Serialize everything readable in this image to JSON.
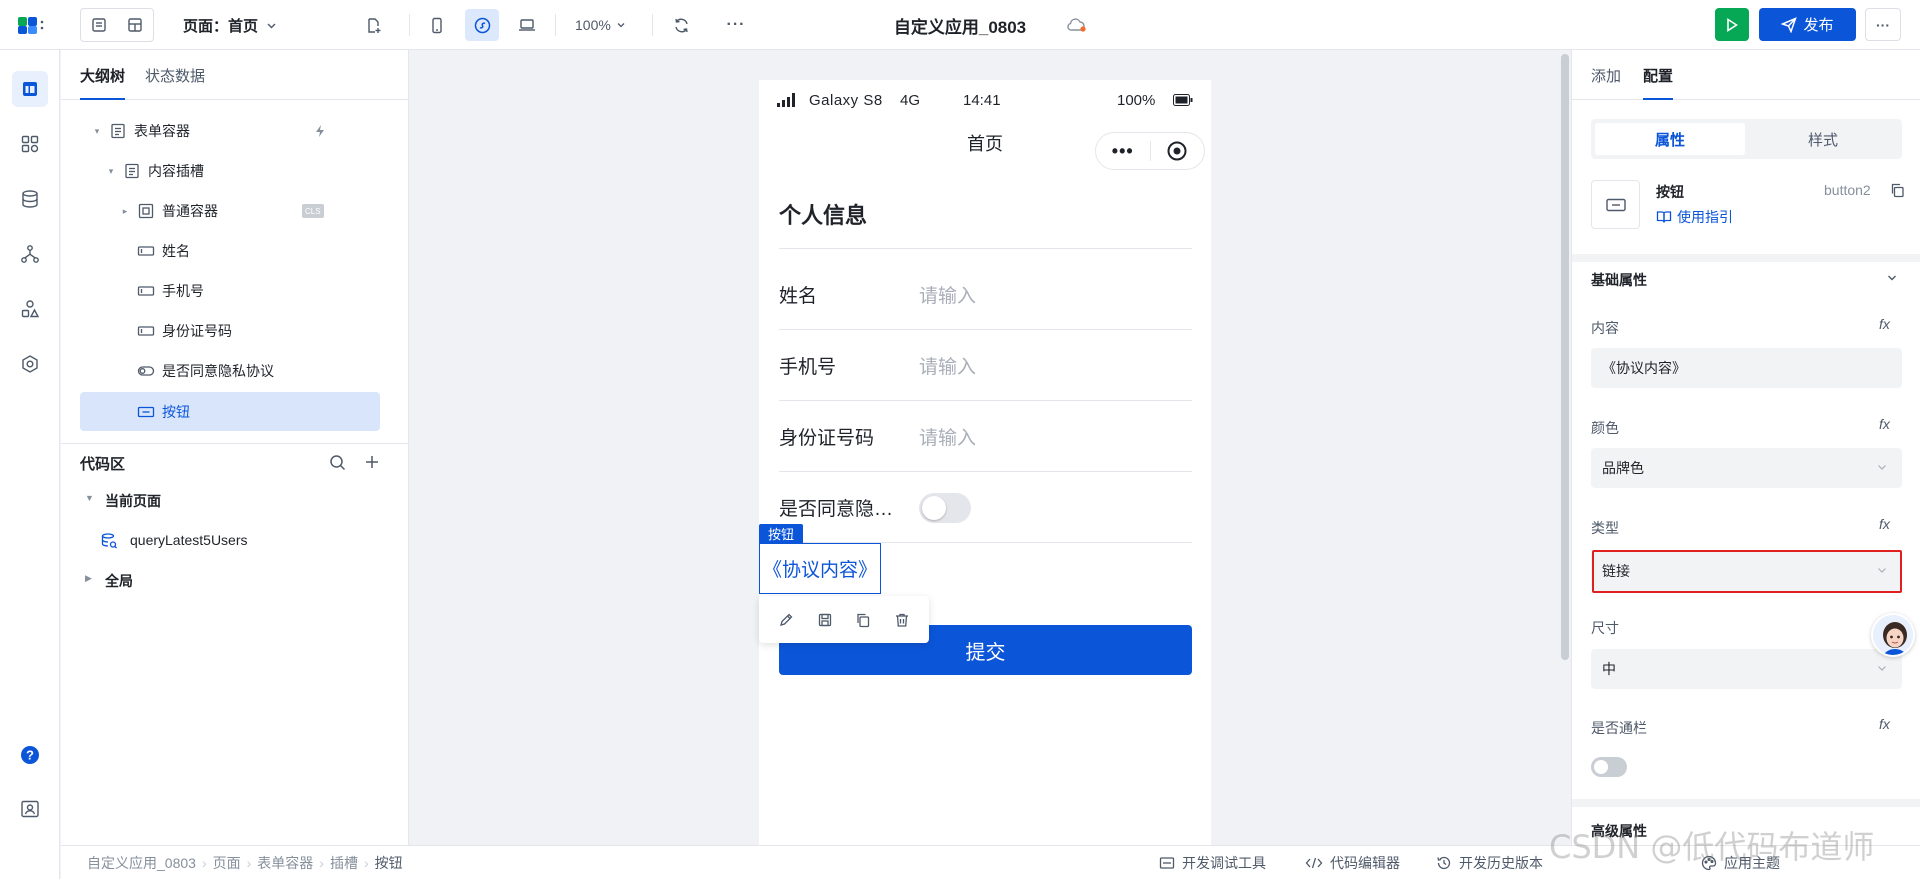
{
  "topbar": {
    "page_selector": "页面：首页",
    "zoom": "100%",
    "app_title": "自定义应用_0803",
    "publish_label": "发布"
  },
  "outline": {
    "tabs": [
      "大纲树",
      "状态数据"
    ],
    "tree": [
      {
        "label": "表单容器",
        "icon": "form-icon",
        "caret": "▾"
      },
      {
        "label": "内容插槽",
        "icon": "form-icon",
        "caret": "▾"
      },
      {
        "label": "普通容器",
        "icon": "container-icon",
        "caret": "▸",
        "badge": "CLS"
      },
      {
        "label": "姓名",
        "icon": "input-icon",
        "caret": ""
      },
      {
        "label": "手机号",
        "icon": "input-icon",
        "caret": ""
      },
      {
        "label": "身份证号码",
        "icon": "input-icon",
        "caret": ""
      },
      {
        "label": "是否同意隐私协议",
        "icon": "switch-icon",
        "caret": ""
      },
      {
        "label": "按钮",
        "icon": "button-icon",
        "caret": "",
        "selected": true
      }
    ],
    "code_area": {
      "title": "代码区",
      "current_page": "当前页面",
      "query": "queryLatest5Users",
      "global": "全局"
    }
  },
  "phone": {
    "carrier": "Galaxy S8",
    "network": "4G",
    "time": "14:41",
    "battery": "100%",
    "page_title": "首页",
    "form_title": "个人信息",
    "fields": [
      {
        "label": "姓名",
        "placeholder": "请输入"
      },
      {
        "label": "手机号",
        "placeholder": "请输入"
      },
      {
        "label": "身份证号码",
        "placeholder": "请输入"
      }
    ],
    "toggle_label": "是否同意隐…",
    "selected_tag": "按钮",
    "link_text": "《协议内容》",
    "submit_label": "提交"
  },
  "rpanel": {
    "tabs": [
      "添加",
      "配置"
    ],
    "seg": [
      "属性",
      "样式"
    ],
    "component_name": "按钮",
    "component_id": "button2",
    "guide_label": "使用指引",
    "section_title": "基础属性",
    "props": [
      {
        "label": "内容",
        "value": "《协议内容》"
      },
      {
        "label": "颜色",
        "value": "品牌色"
      },
      {
        "label": "类型",
        "value": "链接"
      },
      {
        "label": "尺寸",
        "value": "中"
      }
    ],
    "block_label": "是否通栏",
    "advanced_title": "高级属性",
    "fx": "fx"
  },
  "bottombar": {
    "crumbs": [
      "自定义应用_0803",
      "页面",
      "表单容器",
      "插槽",
      "按钮"
    ],
    "tools": [
      "开发调试工具",
      "代码编辑器",
      "开发历史版本",
      "应用主题"
    ]
  },
  "watermark": "CSDN @低代码布道师",
  "colors": {
    "brand": "#0b55d9",
    "run": "#06a755",
    "highlight": "#e02020"
  }
}
